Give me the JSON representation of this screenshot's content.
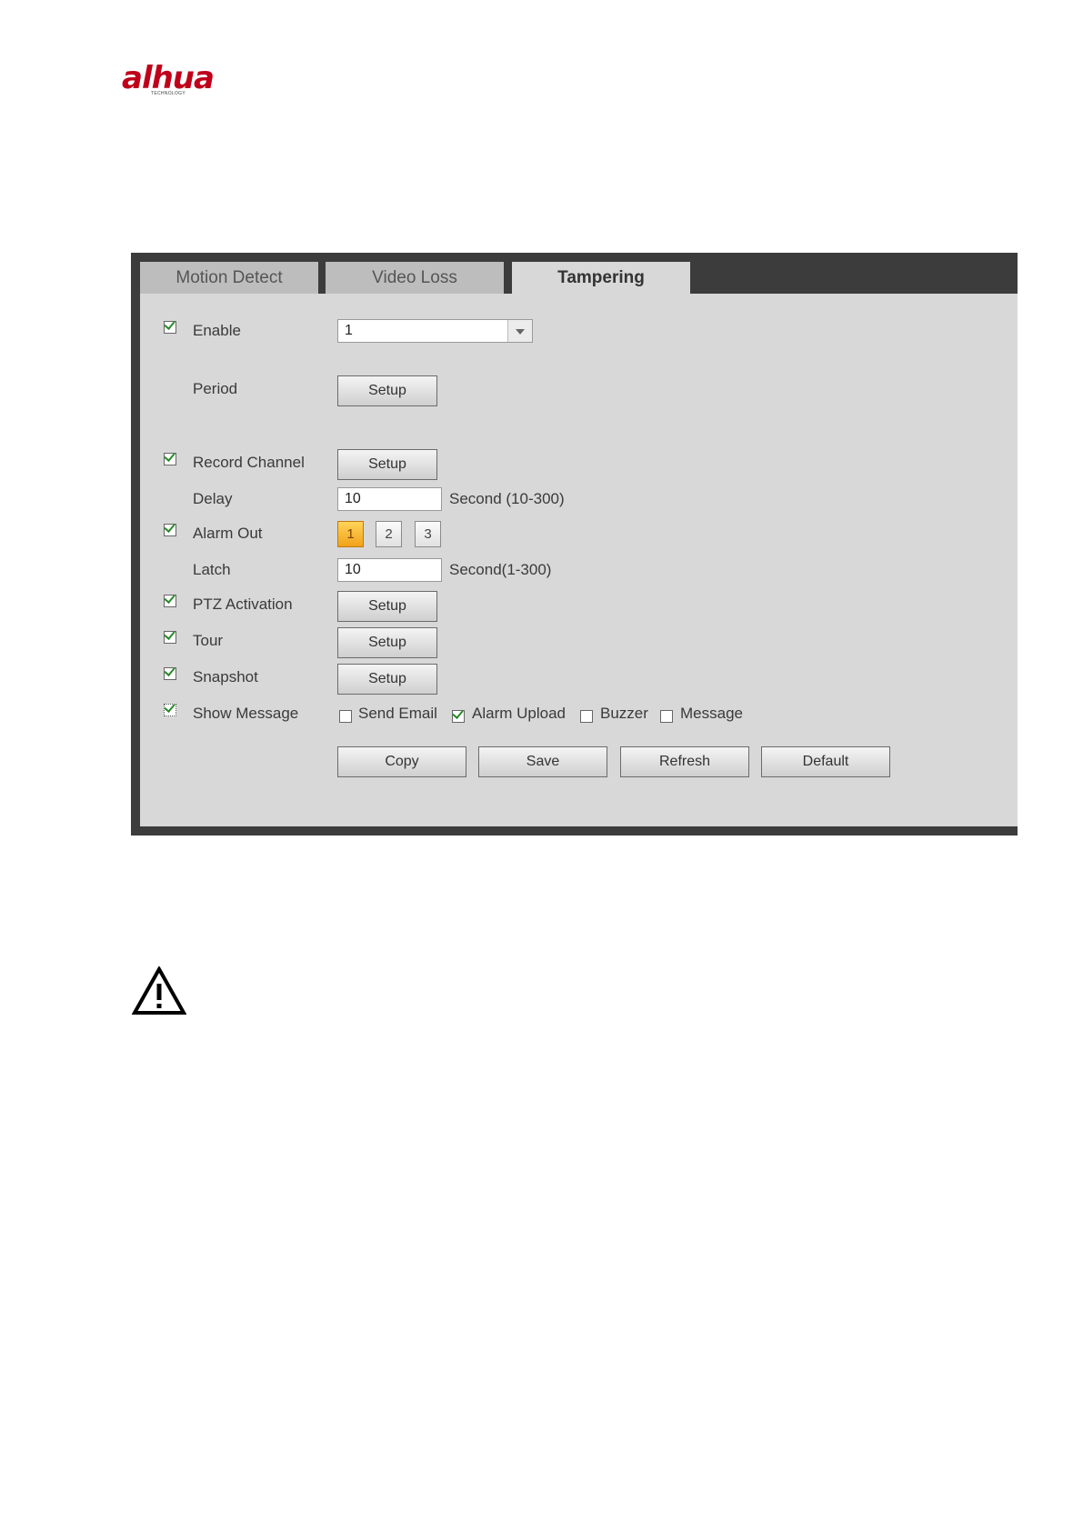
{
  "brand": {
    "logo_text": "alhua",
    "logo_sub": "TECHNOLOGY"
  },
  "tabs": [
    {
      "label": "Motion Detect",
      "active": false
    },
    {
      "label": "Video Loss",
      "active": false
    },
    {
      "label": "Tampering",
      "active": true
    }
  ],
  "form": {
    "enable": {
      "label": "Enable",
      "checked": true,
      "channel_value": "1"
    },
    "period": {
      "label": "Period",
      "button": "Setup"
    },
    "record_channel": {
      "label": "Record Channel",
      "checked": true,
      "button": "Setup"
    },
    "delay": {
      "label": "Delay",
      "value": "10",
      "unit": "Second (10-300)"
    },
    "alarm_out": {
      "label": "Alarm Out",
      "checked": true,
      "outputs": [
        "1",
        "2",
        "3"
      ],
      "selected": "1"
    },
    "latch": {
      "label": "Latch",
      "value": "10",
      "unit": "Second(1-300)"
    },
    "ptz_activation": {
      "label": "PTZ Activation",
      "checked": true,
      "button": "Setup"
    },
    "tour": {
      "label": "Tour",
      "checked": true,
      "button": "Setup"
    },
    "snapshot": {
      "label": "Snapshot",
      "checked": true,
      "button": "Setup"
    },
    "show_message": {
      "label": "Show Message",
      "checked": true,
      "send_email": {
        "label": "Send Email",
        "checked": false
      },
      "alarm_upload": {
        "label": "Alarm Upload",
        "checked": true
      },
      "buzzer": {
        "label": "Buzzer",
        "checked": false
      },
      "message": {
        "label": "Message",
        "checked": false
      }
    }
  },
  "actions": {
    "copy": "Copy",
    "save": "Save",
    "refresh": "Refresh",
    "default": "Default"
  },
  "colors": {
    "brand_red": "#c0001a",
    "panel_dark": "#3c3c3c",
    "panel_bg": "#d8d8d8",
    "check_green": "#2a8a2a",
    "selected_orange": "#f0a21a"
  },
  "icons": {
    "warning": "warning-triangle-icon",
    "dropdown": "chevron-down-icon",
    "check": "checkmark-icon"
  }
}
